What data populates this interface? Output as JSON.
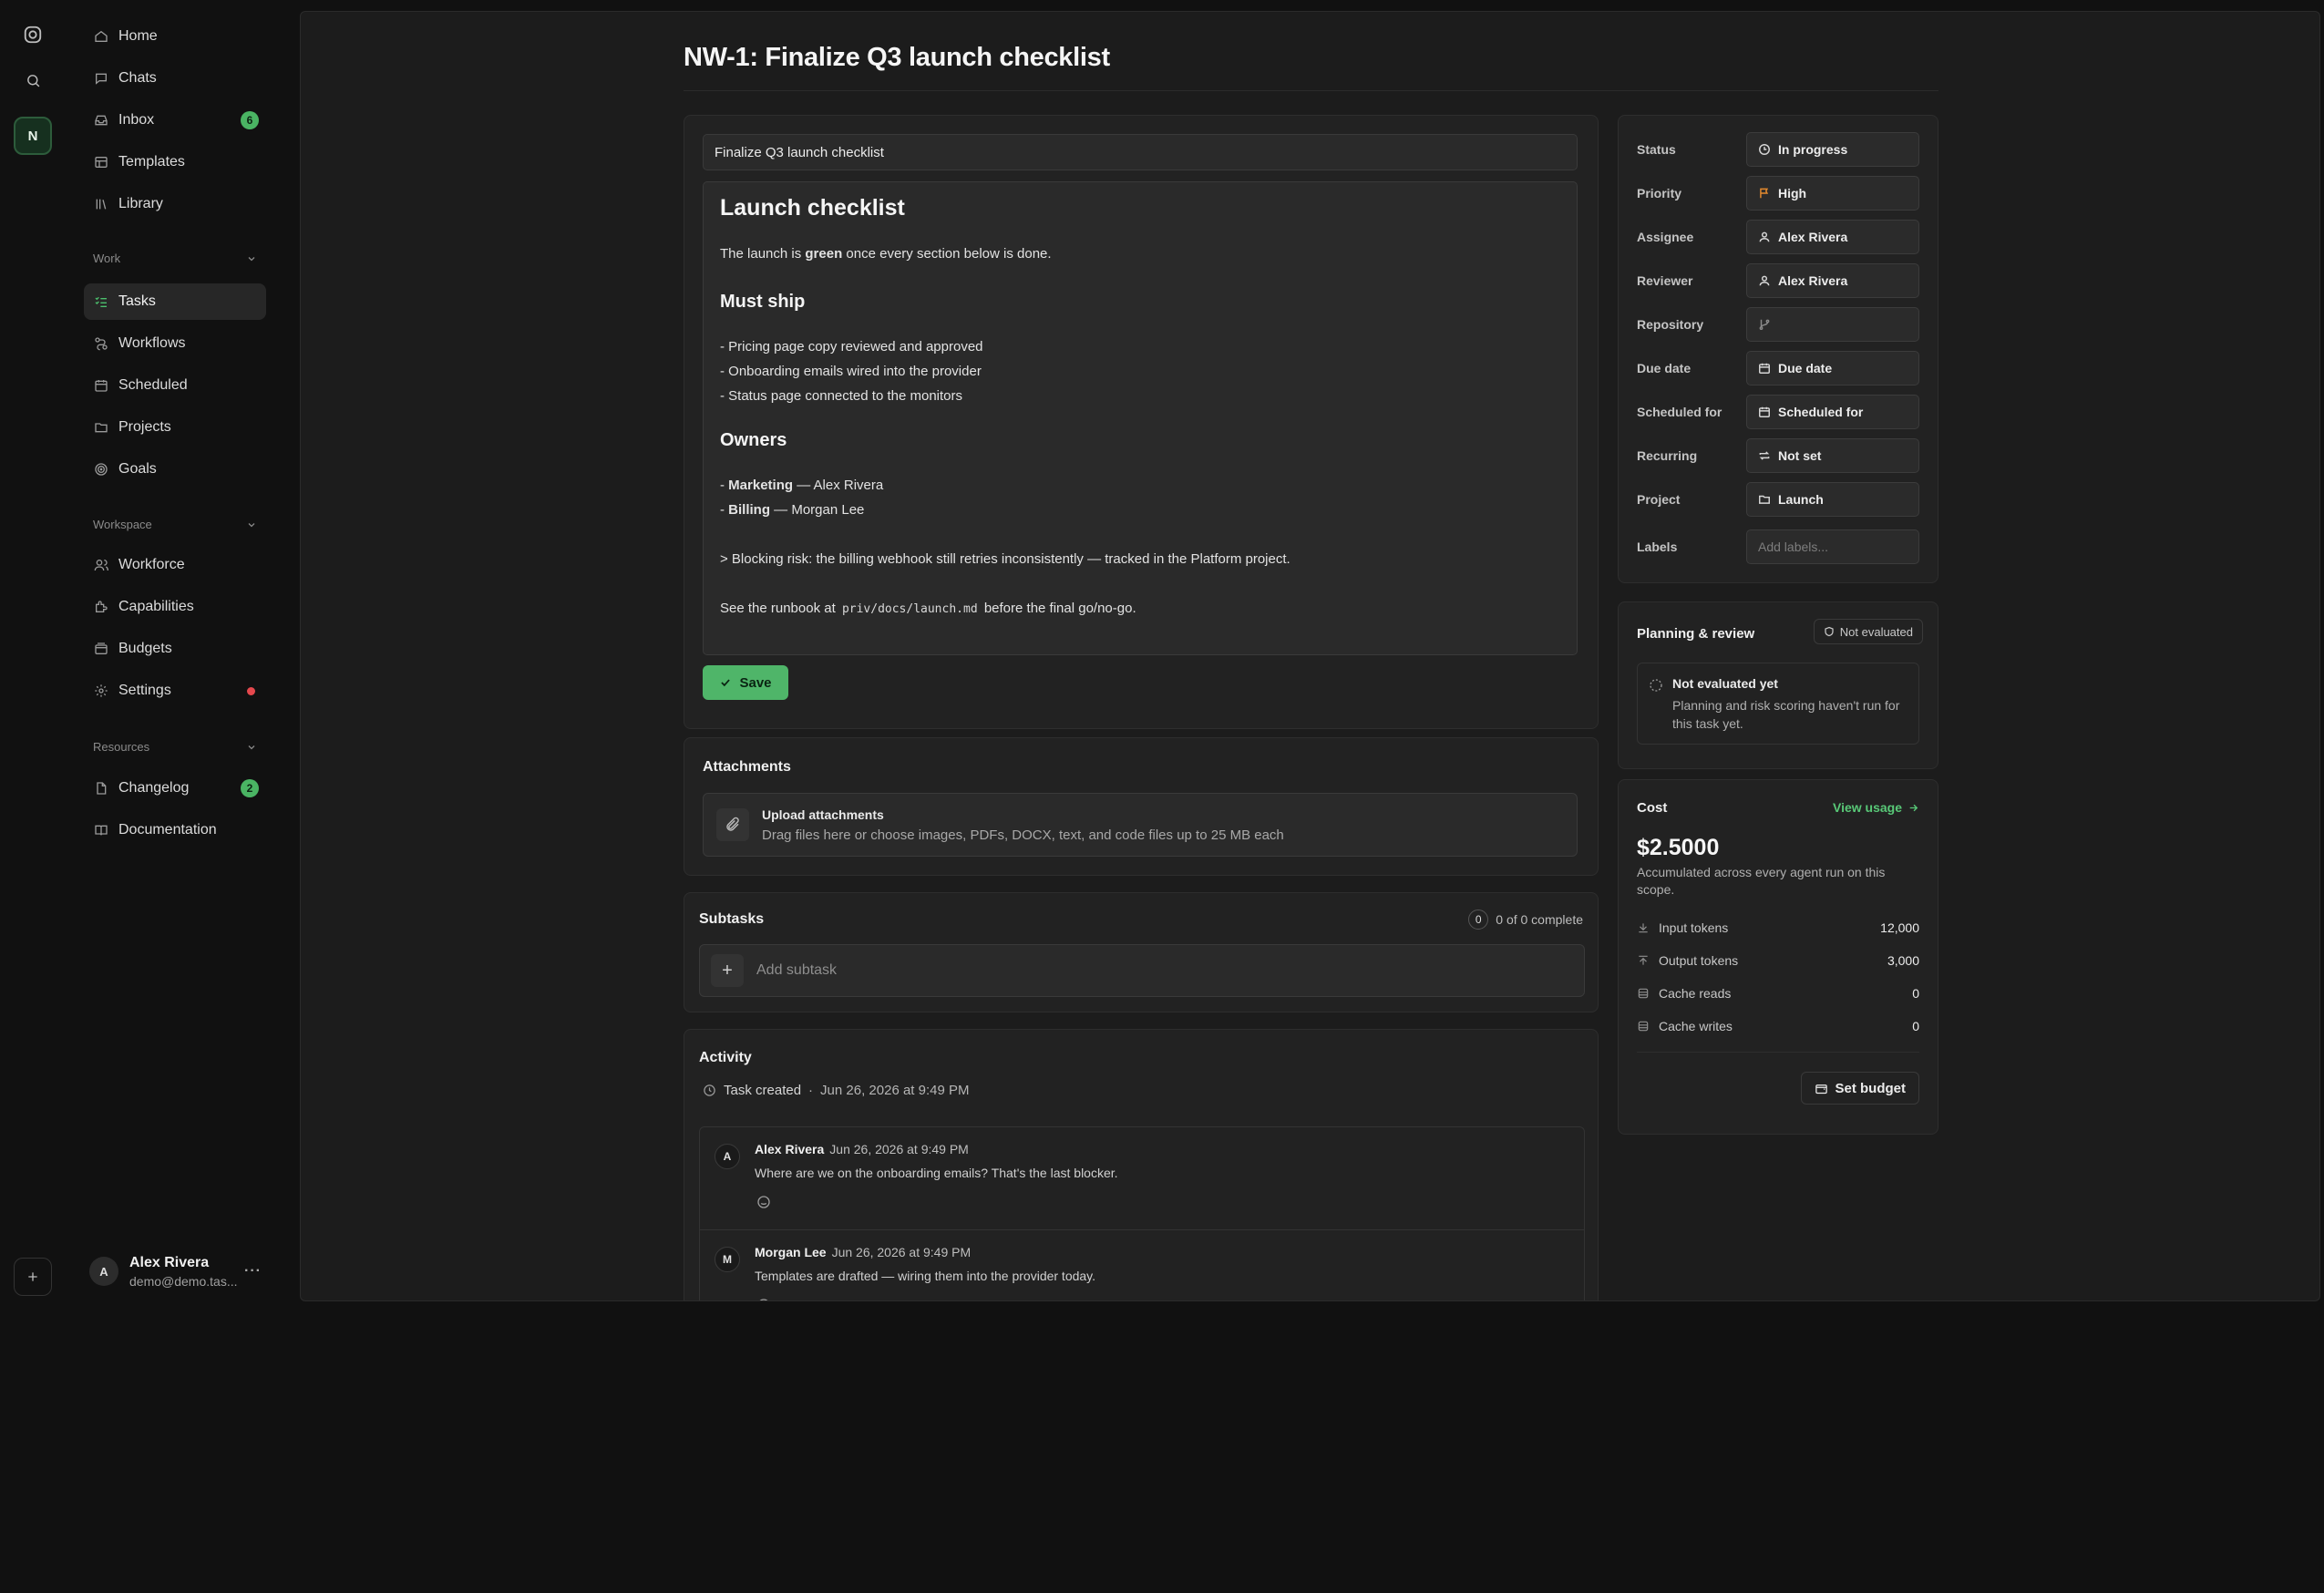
{
  "colors": {
    "accent": "#4fb569",
    "danger": "#e5484d",
    "bg": "#111111",
    "panel": "#1c1c1c",
    "card": "#222222"
  },
  "rail": {
    "workspace_initial": "N",
    "icons": [
      "app-logo-icon",
      "search-icon",
      "plus-icon"
    ]
  },
  "sidebar": {
    "top": [
      {
        "label": "Home",
        "icon": "home-icon"
      },
      {
        "label": "Chats",
        "icon": "chat-icon"
      },
      {
        "label": "Inbox",
        "icon": "inbox-icon",
        "badge": "6"
      },
      {
        "label": "Templates",
        "icon": "template-icon"
      },
      {
        "label": "Library",
        "icon": "library-icon"
      }
    ],
    "work": {
      "title": "Work",
      "items": [
        {
          "label": "Tasks",
          "icon": "tasks-icon",
          "active": true
        },
        {
          "label": "Workflows",
          "icon": "workflow-icon"
        },
        {
          "label": "Scheduled",
          "icon": "calendar-clock-icon"
        },
        {
          "label": "Projects",
          "icon": "folder-icon"
        },
        {
          "label": "Goals",
          "icon": "target-icon"
        }
      ]
    },
    "workspace": {
      "title": "Workspace",
      "items": [
        {
          "label": "Workforce",
          "icon": "users-icon"
        },
        {
          "label": "Capabilities",
          "icon": "puzzle-icon"
        },
        {
          "label": "Budgets",
          "icon": "wallet-icon"
        },
        {
          "label": "Settings",
          "icon": "gear-icon",
          "dot": true
        }
      ]
    },
    "resources": {
      "title": "Resources",
      "items": [
        {
          "label": "Changelog",
          "icon": "document-icon",
          "badge": "2"
        },
        {
          "label": "Documentation",
          "icon": "book-icon"
        }
      ]
    },
    "user": {
      "initial": "A",
      "name": "Alex Rivera",
      "email": "demo@demo.tas..."
    }
  },
  "page": {
    "title": "NW-1: Finalize Q3 launch checklist"
  },
  "editor": {
    "title_value": "Finalize Q3 launch checklist",
    "heading": "Launch checklist",
    "intro_before": "The launch is ",
    "intro_bold": "green",
    "intro_after": " once every section below is done.",
    "must_ship_heading": "Must ship",
    "must_ship": [
      "- Pricing page copy reviewed and approved",
      "- Onboarding emails wired into the provider",
      "- Status page connected to the monitors"
    ],
    "owners_heading": "Owners",
    "owners": [
      {
        "prefix": "- ",
        "team": "Marketing",
        "person": " — Alex Rivera"
      },
      {
        "prefix": "- ",
        "team": "Billing",
        "person": " — Morgan Lee"
      }
    ],
    "quote": "> Blocking risk: the billing webhook still retries inconsistently — tracked in the Platform project.",
    "runbook_before": "See the runbook at ",
    "runbook_code": "priv/docs/launch.md",
    "runbook_after": " before the final go/no-go.",
    "save_label": "Save"
  },
  "attachments": {
    "title": "Attachments",
    "upload_title": "Upload attachments",
    "upload_sub": "Drag files here or choose images, PDFs, DOCX, text, and code files up to 25 MB each"
  },
  "subtasks": {
    "title": "Subtasks",
    "count": "0",
    "progress": "0 of 0 complete",
    "add_placeholder": "Add subtask"
  },
  "activity": {
    "title": "Activity",
    "created_label": "Task created",
    "created_sep": "·",
    "created_time": "Jun 26, 2026 at 9:49 PM",
    "comments": [
      {
        "initial": "A",
        "author": "Alex Rivera",
        "time": "Jun 26, 2026 at 9:49 PM",
        "body": "Where are we on the onboarding emails? That's the last blocker."
      },
      {
        "initial": "M",
        "author": "Morgan Lee",
        "time": "Jun 26, 2026 at 9:49 PM",
        "body": "Templates are drafted — wiring them into the provider today."
      }
    ]
  },
  "properties": [
    {
      "label": "Status",
      "value": "In progress",
      "icon": "progress-circle-icon"
    },
    {
      "label": "Priority",
      "value": "High",
      "icon": "flag-icon"
    },
    {
      "label": "Assignee",
      "value": "Alex Rivera",
      "icon": "user-icon"
    },
    {
      "label": "Reviewer",
      "value": "Alex Rivera",
      "icon": "user-icon"
    },
    {
      "label": "Repository",
      "value": "",
      "icon": "git-branch-icon"
    },
    {
      "label": "Due date",
      "value": "Due date",
      "icon": "calendar-icon"
    },
    {
      "label": "Scheduled for",
      "value": "Scheduled for",
      "icon": "calendar-clock-icon"
    },
    {
      "label": "Recurring",
      "value": "Not set",
      "icon": "repeat-icon"
    },
    {
      "label": "Project",
      "value": "Launch",
      "icon": "folder-icon"
    },
    {
      "label": "Labels",
      "value": "",
      "placeholder": "Add labels...",
      "icon": ""
    }
  ],
  "planning": {
    "title": "Planning & review",
    "pill": "Not evaluated",
    "box_title": "Not evaluated yet",
    "box_text": "Planning and risk scoring haven't run for this task yet."
  },
  "cost": {
    "title": "Cost",
    "link": "View usage",
    "amount": "$2.5000",
    "sub": "Accumulated across every agent run on this scope.",
    "rows": [
      {
        "label": "Input tokens",
        "value": "12,000",
        "icon": "arrow-down-to-line-icon"
      },
      {
        "label": "Output tokens",
        "value": "3,000",
        "icon": "arrow-up-from-line-icon"
      },
      {
        "label": "Cache reads",
        "value": "0",
        "icon": "database-icon"
      },
      {
        "label": "Cache writes",
        "value": "0",
        "icon": "database-icon"
      }
    ],
    "budget_label": "Set budget"
  }
}
